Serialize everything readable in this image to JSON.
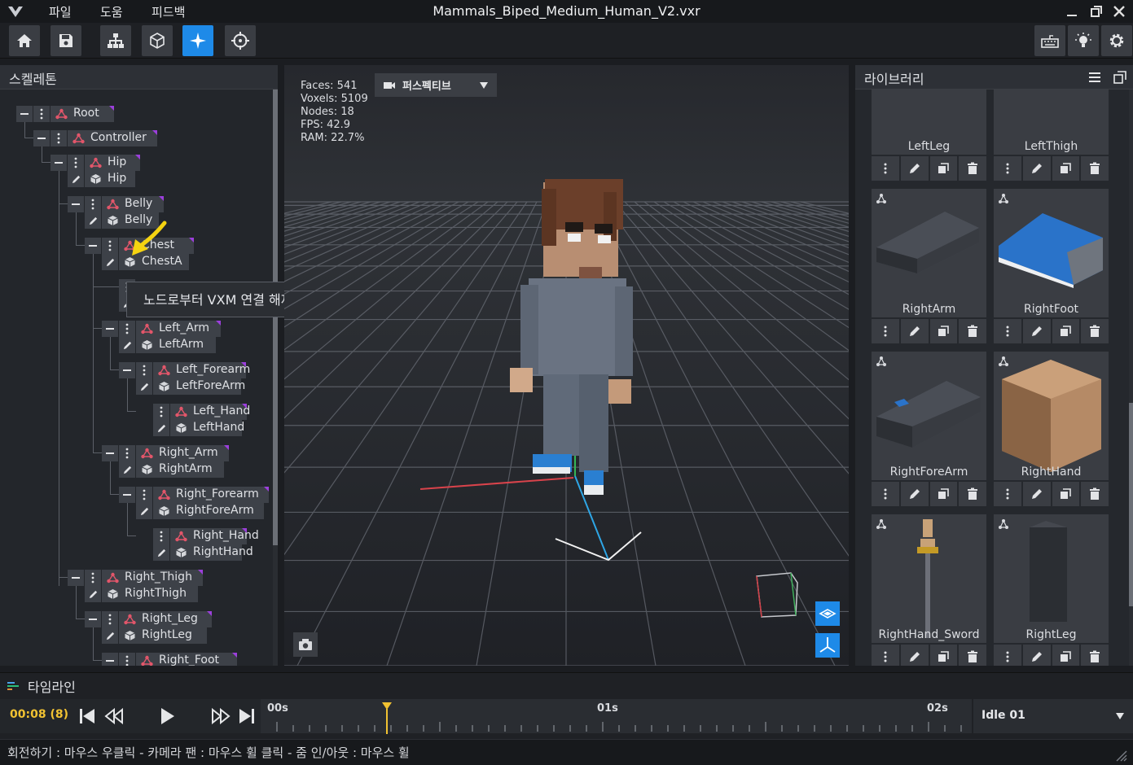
{
  "window": {
    "title": "Mammals_Biped_Medium_Human_V2.vxr",
    "menu": [
      "파일",
      "도움",
      "피드백"
    ]
  },
  "toolbar": {
    "left_icons": [
      "home-icon",
      "save-icon",
      "hierarchy-icon",
      "cube-icon",
      "sparkle-icon",
      "target-icon"
    ],
    "right_icons": [
      "keyboard-icon",
      "light-icon",
      "gear-icon"
    ],
    "active": "sparkle-icon",
    "accent": "#1e8ae8"
  },
  "skeleton": {
    "title": "스켈레톤",
    "nodes": [
      {
        "bone": "Root",
        "mesh": ""
      },
      {
        "bone": "Controller",
        "mesh": ""
      },
      {
        "bone": "Hip",
        "mesh": "Hip"
      },
      {
        "bone": "Belly",
        "mesh": "Belly"
      },
      {
        "bone": "Chest",
        "mesh": "ChestA"
      },
      {
        "bone": "",
        "mesh": ""
      },
      {
        "bone": "Left_Arm",
        "mesh": "LeftArm"
      },
      {
        "bone": "Left_Forearm",
        "mesh": "LeftForeArm"
      },
      {
        "bone": "Left_Hand",
        "mesh": "LeftHand"
      },
      {
        "bone": "Right_Arm",
        "mesh": "RightArm"
      },
      {
        "bone": "Right_Forearm",
        "mesh": "RightForeArm"
      },
      {
        "bone": "Right_Hand",
        "mesh": "RightHand"
      },
      {
        "bone": "Right_Thigh",
        "mesh": "RightThigh"
      },
      {
        "bone": "Right_Leg",
        "mesh": "RightLeg"
      },
      {
        "bone": "Right_Foot",
        "mesh": ""
      }
    ],
    "tooltip": "노드로부터 VXM 연결 해제"
  },
  "viewport": {
    "stats": {
      "faces": "Faces: 541",
      "voxels": "Voxels: 5109",
      "nodes": "Nodes: 18",
      "fps": "FPS: 42.9",
      "ram": "RAM: 22.7%"
    },
    "camera_mode": "퍼스펙티브"
  },
  "library": {
    "title": "라이브러리",
    "items": [
      "LeftLeg",
      "LeftThigh",
      "RightArm",
      "RightFoot",
      "RightForeArm",
      "RightHand",
      "RightHand_Sword",
      "RightLeg"
    ]
  },
  "timeline": {
    "title": "타임라인",
    "current_time": "00:08 (8)",
    "marks": [
      "00s",
      "01s",
      "02s"
    ],
    "animation": "Idle 01",
    "playhead_color": "#f1c232"
  },
  "status": {
    "hint": "회전하기 : 마우스 우클릭 - 카메라 팬 : 마우스 휠 클릭 - 줌 인/아웃 : 마우스 휠"
  }
}
